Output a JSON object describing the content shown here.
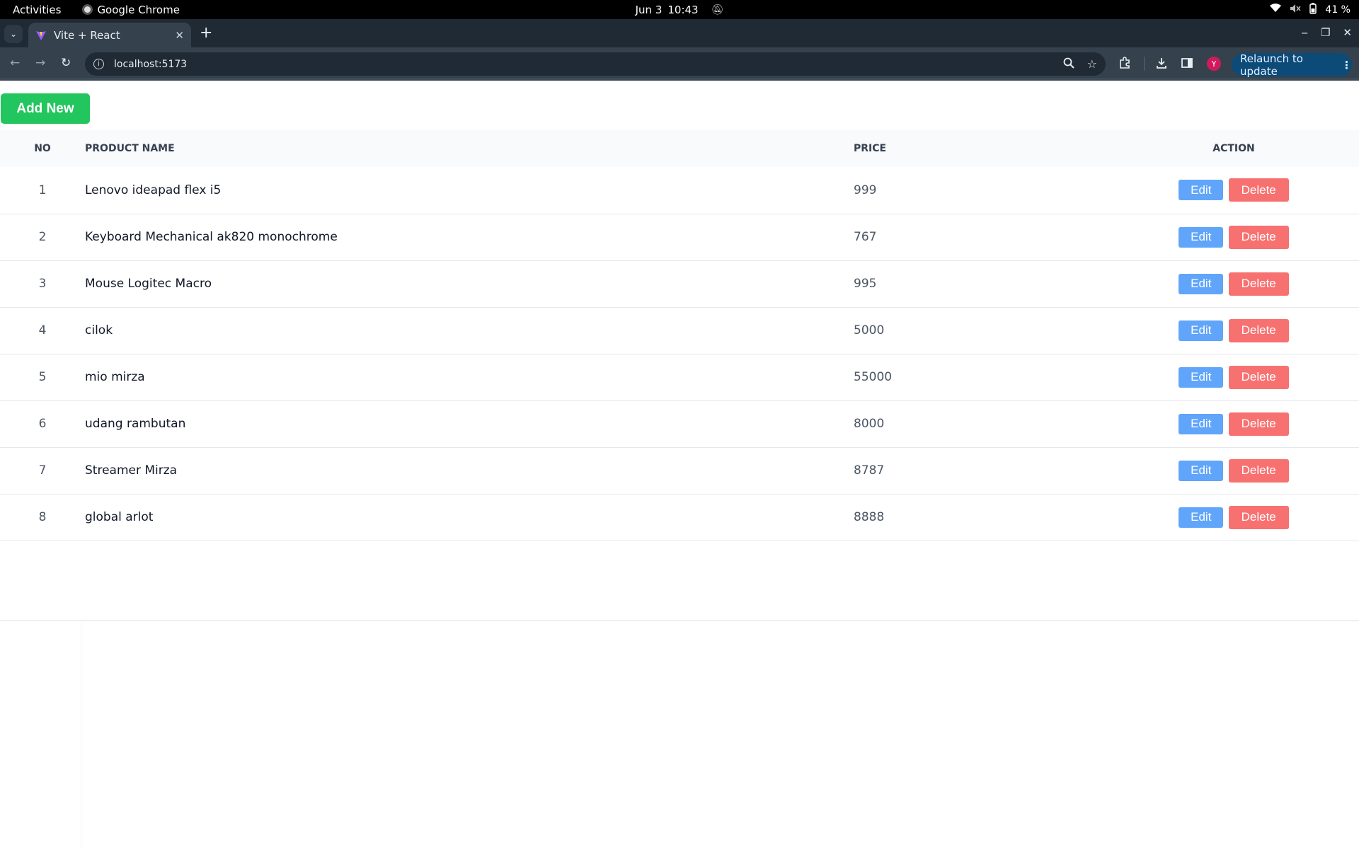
{
  "system_bar": {
    "activities": "Activities",
    "app_name": "Google Chrome",
    "date": "Jun 3",
    "time": "10:43",
    "battery": "41 %"
  },
  "browser": {
    "tab_title": "Vite + React",
    "url": "localhost:5173",
    "relaunch_label": "Relaunch to update",
    "profile_initial": "Y"
  },
  "page": {
    "add_button": "Add New",
    "columns": {
      "no": "NO",
      "name": "PRODUCT NAME",
      "price": "PRICE",
      "action": "ACTION"
    },
    "edit_label": "Edit",
    "delete_label": "Delete",
    "rows": [
      {
        "no": "1",
        "name": "Lenovo ideapad flex i5",
        "price": "999"
      },
      {
        "no": "2",
        "name": "Keyboard Mechanical ak820 monochrome",
        "price": "767"
      },
      {
        "no": "3",
        "name": "Mouse Logitec Macro",
        "price": "995"
      },
      {
        "no": "4",
        "name": "cilok",
        "price": "5000"
      },
      {
        "no": "5",
        "name": "mio mirza",
        "price": "55000"
      },
      {
        "no": "6",
        "name": "udang rambutan",
        "price": "8000"
      },
      {
        "no": "7",
        "name": "Streamer Mirza",
        "price": "8787"
      },
      {
        "no": "8",
        "name": "global arlot",
        "price": "8888"
      }
    ]
  },
  "colors": {
    "add_button": "#22c55e",
    "edit_button": "#60a5fa",
    "delete_button": "#f87171"
  }
}
